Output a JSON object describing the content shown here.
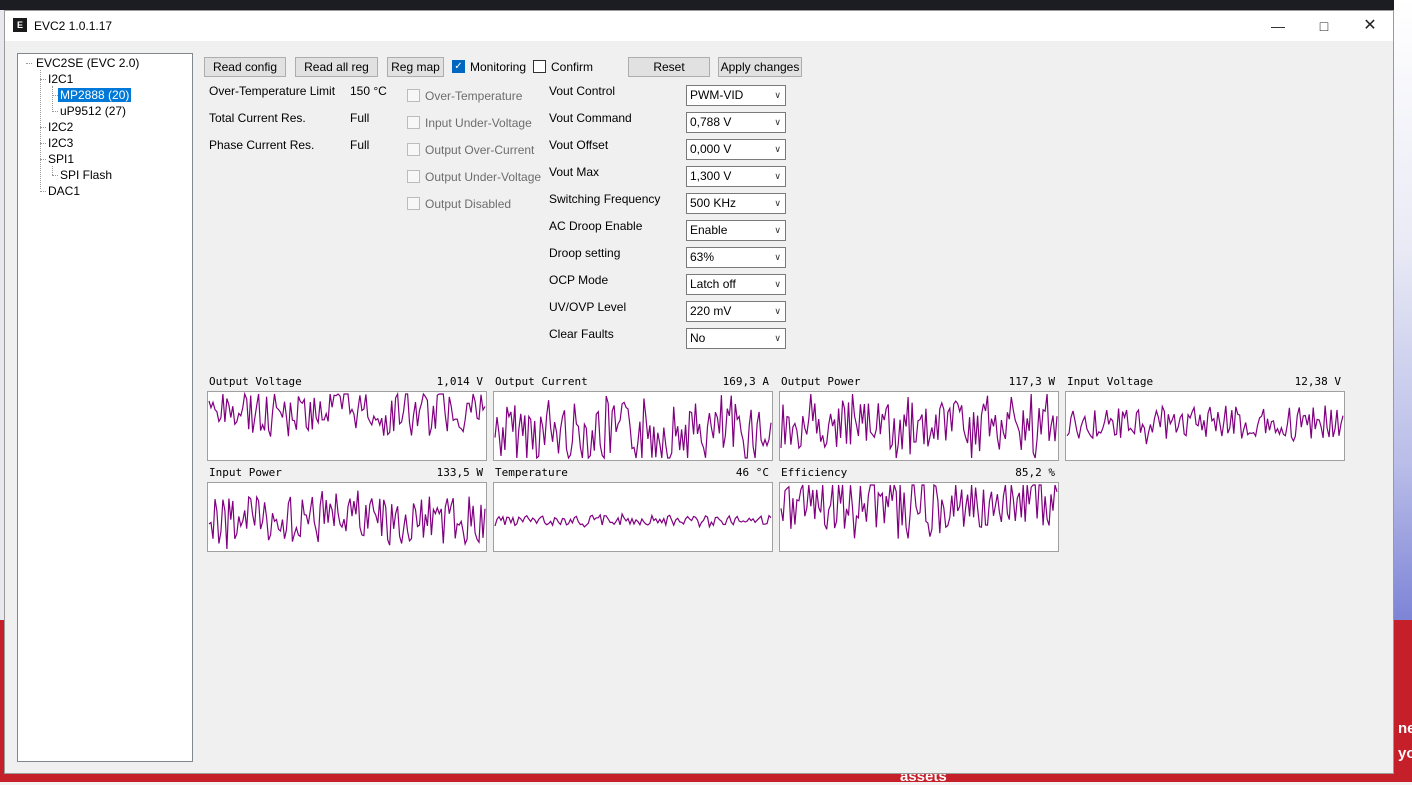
{
  "window": {
    "title": "EVC2 1.0.1.17",
    "icon_text": "E"
  },
  "background": {
    "partial_text_1": "ne",
    "partial_text_2": "yo",
    "partial_text_3": "assets"
  },
  "tree": {
    "root": "EVC2SE (EVC 2.0)",
    "items": [
      {
        "label": "I2C1"
      },
      {
        "label": "MP2888 (20)"
      },
      {
        "label": "uP9512 (27)"
      },
      {
        "label": "I2C2"
      },
      {
        "label": "I2C3"
      },
      {
        "label": "SPI1"
      },
      {
        "label": "SPI Flash"
      },
      {
        "label": "DAC1"
      }
    ]
  },
  "toolbar": {
    "read_config": "Read config",
    "read_all_reg": "Read all reg",
    "reg_map": "Reg map",
    "monitoring": "Monitoring",
    "monitoring_checked": true,
    "confirm": "Confirm",
    "confirm_checked": false,
    "reset": "Reset",
    "apply_changes": "Apply changes"
  },
  "info": [
    {
      "label": "Over-Temperature Limit",
      "value": "150 °C"
    },
    {
      "label": "Total Current Res.",
      "value": "Full"
    },
    {
      "label": "Phase Current Res.",
      "value": "Full"
    }
  ],
  "status_flags": [
    {
      "label": "Over-Temperature",
      "checked": false
    },
    {
      "label": "Input Under-Voltage",
      "checked": false
    },
    {
      "label": "Output Over-Current",
      "checked": false
    },
    {
      "label": "Output Under-Voltage",
      "checked": false
    },
    {
      "label": "Output Disabled",
      "checked": false
    }
  ],
  "settings": [
    {
      "label": "Vout Control",
      "value": "PWM-VID"
    },
    {
      "label": "Vout Command",
      "value": "0,788 V"
    },
    {
      "label": "Vout Offset",
      "value": "0,000 V"
    },
    {
      "label": "Vout Max",
      "value": "1,300 V"
    },
    {
      "label": "Switching Frequency",
      "value": "500 KHz"
    },
    {
      "label": "AC Droop Enable",
      "value": "Enable"
    },
    {
      "label": "Droop setting",
      "value": "63%"
    },
    {
      "label": "OCP Mode",
      "value": "Latch off"
    },
    {
      "label": "UV/OVP Level",
      "value": "220 mV"
    },
    {
      "label": "Clear Faults",
      "value": "No"
    }
  ],
  "monitors": [
    {
      "title": "Output Voltage",
      "value": "1,014 V",
      "seed": 3,
      "amp": 0.6,
      "base": 0.7
    },
    {
      "title": "Output Current",
      "value": "169,3 A",
      "seed": 7,
      "amp": 0.9,
      "base": 0.4
    },
    {
      "title": "Output Power",
      "value": "117,3 W",
      "seed": 11,
      "amp": 0.8,
      "base": 0.5
    },
    {
      "title": "Input Voltage",
      "value": "12,38 V",
      "seed": 5,
      "amp": 0.5,
      "base": 0.55
    },
    {
      "title": "Input Power",
      "value": "133,5 W",
      "seed": 13,
      "amp": 0.7,
      "base": 0.45
    },
    {
      "title": "Temperature",
      "value": "46 °C",
      "seed": 17,
      "amp": 0.15,
      "base": 0.45
    },
    {
      "title": "Efficiency",
      "value": "85,2 %",
      "seed": 19,
      "amp": 0.8,
      "base": 0.7
    }
  ],
  "colors": {
    "trace": "#800080",
    "selection": "#0078d7",
    "check": "#0067c0"
  }
}
